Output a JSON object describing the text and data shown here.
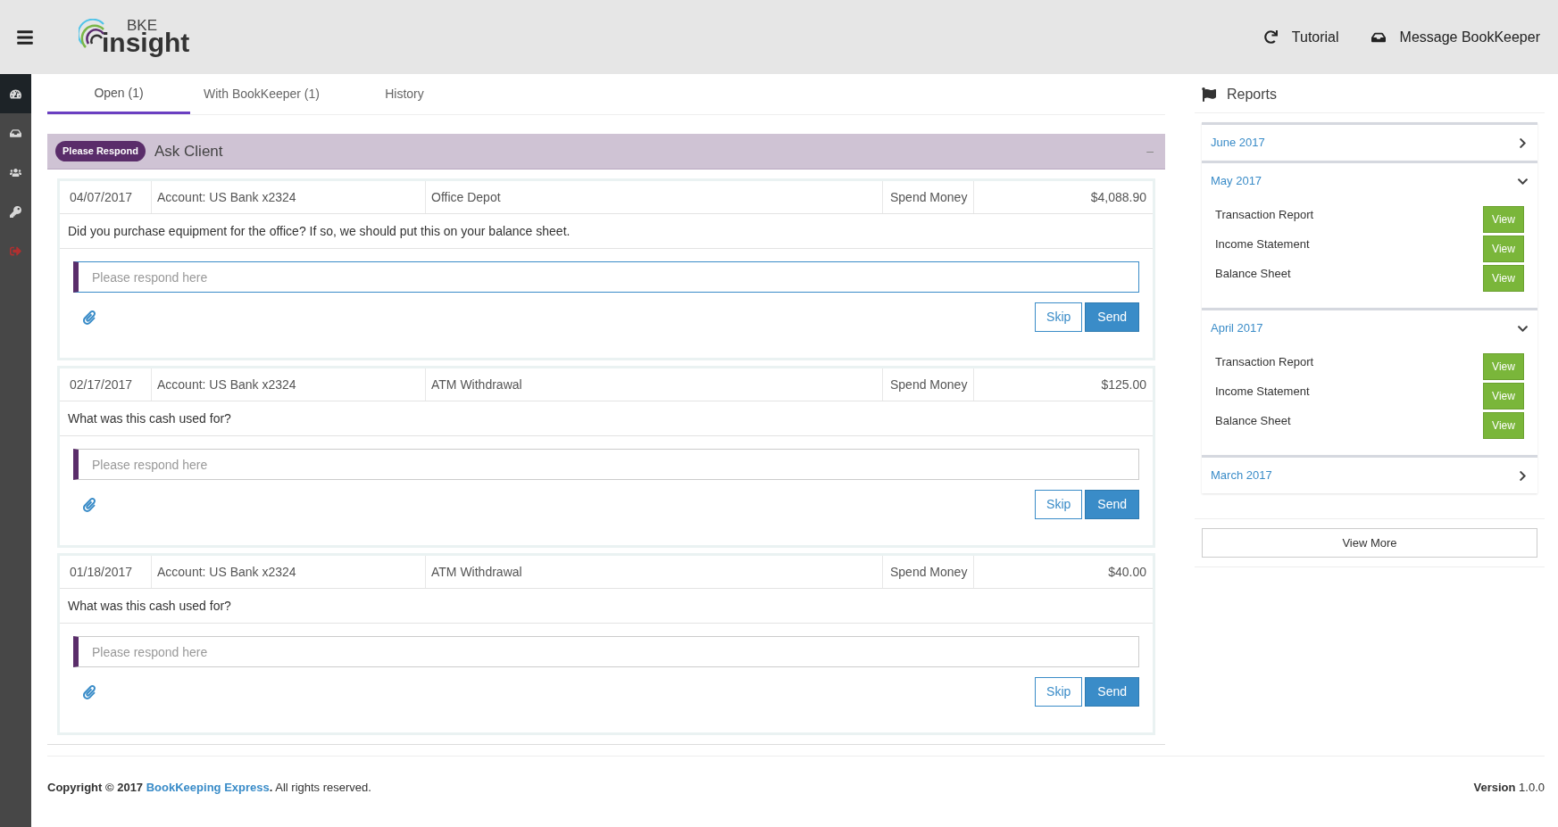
{
  "header": {
    "logo_small": "BKE",
    "logo_large": "insight",
    "actions": [
      {
        "kind": "tutorial",
        "label": "Tutorial"
      },
      {
        "kind": "message",
        "label": "Message BookKeeper"
      }
    ]
  },
  "sidebar": {
    "items": [
      {
        "kind": "dashboard",
        "selected": true
      },
      {
        "kind": "inbox",
        "selected": false
      },
      {
        "kind": "users",
        "selected": false
      },
      {
        "kind": "key",
        "selected": false
      },
      {
        "kind": "logout",
        "selected": false
      }
    ]
  },
  "tabs": [
    {
      "label": "Open (1)",
      "selected": true
    },
    {
      "label": "With BookKeeper (1)",
      "selected": false
    },
    {
      "label": "History",
      "selected": false
    }
  ],
  "panel": {
    "badge": "Please Respond",
    "title": "Ask Client",
    "collapse": "–"
  },
  "questions": [
    {
      "date": "04/07/2017",
      "account": "Account: US Bank x2324",
      "payee": "Office Depot",
      "type": "Spend Money",
      "amount": "$4,088.90",
      "question": "Did you purchase equipment for the office? If so, we should put this on your balance sheet.",
      "placeholder": "Please respond here",
      "focused": true,
      "skip": "Skip",
      "send": "Send"
    },
    {
      "date": "02/17/2017",
      "account": "Account: US Bank x2324",
      "payee": "ATM Withdrawal",
      "type": "Spend Money",
      "amount": "$125.00",
      "question": "What was this cash used for?",
      "placeholder": "Please respond here",
      "focused": false,
      "skip": "Skip",
      "send": "Send"
    },
    {
      "date": "01/18/2017",
      "account": "Account: US Bank x2324",
      "payee": "ATM Withdrawal",
      "type": "Spend Money",
      "amount": "$40.00",
      "question": "What was this cash used for?",
      "placeholder": "Please respond here",
      "focused": false,
      "skip": "Skip",
      "send": "Send"
    }
  ],
  "reports": {
    "title": "Reports",
    "months": [
      {
        "label": "June 2017",
        "expanded": false
      },
      {
        "label": "May 2017",
        "expanded": true,
        "items": [
          {
            "name": "Transaction Report",
            "button": "View"
          },
          {
            "name": "Income Statement",
            "button": "View"
          },
          {
            "name": "Balance Sheet",
            "button": "View"
          }
        ]
      },
      {
        "label": "April 2017",
        "expanded": true,
        "items": [
          {
            "name": "Transaction Report",
            "button": "View"
          },
          {
            "name": "Income Statement",
            "button": "View"
          },
          {
            "name": "Balance Sheet",
            "button": "View"
          }
        ]
      },
      {
        "label": "March 2017",
        "expanded": false
      }
    ],
    "view_more": "View More"
  },
  "footer": {
    "copyright_prefix": "Copyright © 2017",
    "company": "BookKeeping Express",
    "company_end": ".",
    "copyright_suffix": "All rights reserved.",
    "version_label": "Version",
    "version": "1.0.0"
  }
}
